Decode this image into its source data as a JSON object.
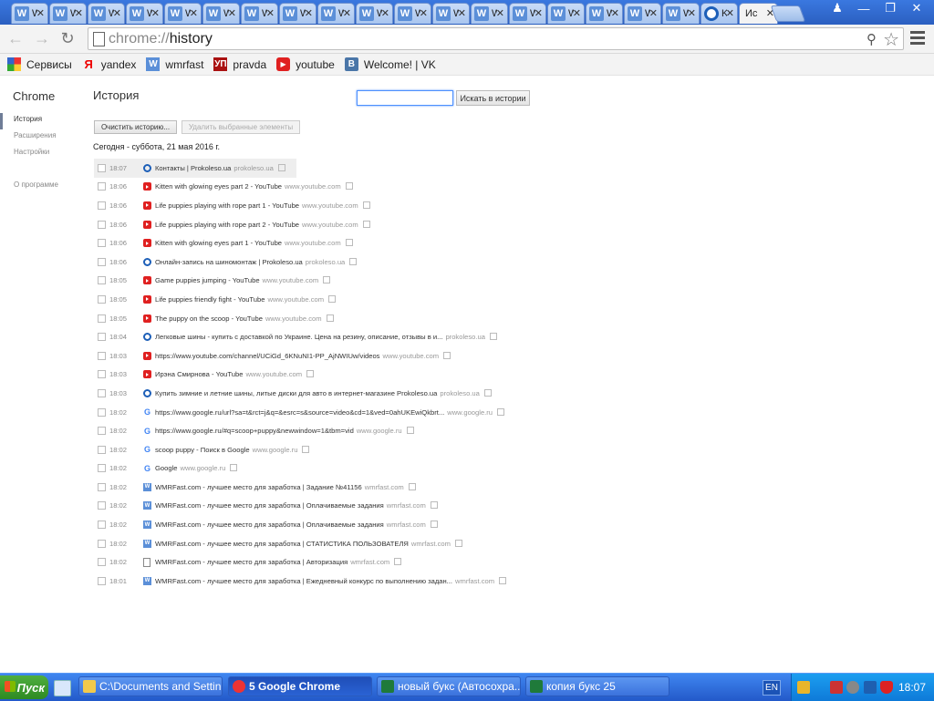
{
  "browser": {
    "tabs": [
      {
        "icon": "w",
        "title": "W"
      },
      {
        "icon": "w",
        "title": "W"
      },
      {
        "icon": "w",
        "title": "W"
      },
      {
        "icon": "w",
        "title": "W"
      },
      {
        "icon": "w",
        "title": "W"
      },
      {
        "icon": "w",
        "title": "W"
      },
      {
        "icon": "w",
        "title": "W"
      },
      {
        "icon": "w",
        "title": "W"
      },
      {
        "icon": "w",
        "title": "W"
      },
      {
        "icon": "w",
        "title": "W"
      },
      {
        "icon": "w",
        "title": "W"
      },
      {
        "icon": "w",
        "title": "W"
      },
      {
        "icon": "w",
        "title": "W"
      },
      {
        "icon": "w",
        "title": "W"
      },
      {
        "icon": "w",
        "title": "W"
      },
      {
        "icon": "w",
        "title": "W"
      },
      {
        "icon": "w",
        "title": "W"
      },
      {
        "icon": "w",
        "title": "W"
      },
      {
        "icon": "prokoleso",
        "title": "K"
      },
      {
        "icon": "none",
        "title": "Ис",
        "active": true
      }
    ],
    "url_scheme": "chrome://",
    "url_host": "history",
    "bookmarks": [
      {
        "icon": "apps",
        "label": "Сервисы"
      },
      {
        "icon": "yandex",
        "label": "yandex"
      },
      {
        "icon": "wmrfast",
        "label": "wmrfast"
      },
      {
        "icon": "pravda",
        "label": "pravda"
      },
      {
        "icon": "youtube",
        "label": "youtube"
      },
      {
        "icon": "vk",
        "label": "Welcome! | VK"
      }
    ]
  },
  "page": {
    "brand": "Chrome",
    "nav": [
      "История",
      "Расширения",
      "Настройки",
      "О программе"
    ],
    "title": "История",
    "search_button": "Искать в истории",
    "clear_button": "Очистить историю...",
    "delete_button": "Удалить выбранные элементы",
    "day_heading": "Сегодня - суббота, 21 мая 2016 г."
  },
  "entries": [
    {
      "time": "18:07",
      "icon": "prokoleso",
      "title": "Контакты | Prokoleso.ua",
      "domain": "prokoleso.ua"
    },
    {
      "time": "18:06",
      "icon": "youtube",
      "title": "Kitten with glowing eyes part 2 - YouTube",
      "domain": "www.youtube.com"
    },
    {
      "time": "18:06",
      "icon": "youtube",
      "title": "Life puppies playing with rope part 1 - YouTube",
      "domain": "www.youtube.com"
    },
    {
      "time": "18:06",
      "icon": "youtube",
      "title": "Life puppies playing with rope part 2 - YouTube",
      "domain": "www.youtube.com"
    },
    {
      "time": "18:06",
      "icon": "youtube",
      "title": "Kitten with glowing eyes part 1 - YouTube",
      "domain": "www.youtube.com"
    },
    {
      "time": "18:06",
      "icon": "prokoleso",
      "title": "Онлайн-запись на шиномонтаж | Prokoleso.ua",
      "domain": "prokoleso.ua"
    },
    {
      "time": "18:05",
      "icon": "youtube",
      "title": "Game puppies jumping - YouTube",
      "domain": "www.youtube.com"
    },
    {
      "time": "18:05",
      "icon": "youtube",
      "title": "Life puppies friendly fight - YouTube",
      "domain": "www.youtube.com"
    },
    {
      "time": "18:05",
      "icon": "youtube",
      "title": "The puppy on the scoop - YouTube",
      "domain": "www.youtube.com"
    },
    {
      "time": "18:04",
      "icon": "prokoleso",
      "title": "Легковые шины - купить с доставкой по Украине. Цена на резину, описание, отзывы в и...",
      "domain": "prokoleso.ua"
    },
    {
      "time": "18:03",
      "icon": "youtube",
      "title": "https://www.youtube.com/channel/UCiGd_6KNuNI1-PP_AjNWIUw/videos",
      "domain": "www.youtube.com"
    },
    {
      "time": "18:03",
      "icon": "youtube",
      "title": "Ирэна Смирнова - YouTube",
      "domain": "www.youtube.com"
    },
    {
      "time": "18:03",
      "icon": "prokoleso",
      "title": "Купить зимние и летние шины, литые диски для авто в интернет-магазине Prokoleso.ua",
      "domain": "prokoleso.ua"
    },
    {
      "time": "18:02",
      "icon": "google",
      "title": "https://www.google.ru/url?sa=t&rct=j&q=&esrc=s&source=video&cd=1&ved=0ahUKEwiQkbrt...",
      "domain": "www.google.ru"
    },
    {
      "time": "18:02",
      "icon": "google",
      "title": "https://www.google.ru/#q=scoop+puppy&newwindow=1&tbm=vid",
      "domain": "www.google.ru"
    },
    {
      "time": "18:02",
      "icon": "google",
      "title": "scoop puppy - Поиск в Google",
      "domain": "www.google.ru"
    },
    {
      "time": "18:02",
      "icon": "google",
      "title": "Google",
      "domain": "www.google.ru"
    },
    {
      "time": "18:02",
      "icon": "wmrfast",
      "title": "WMRFast.com - лучшее место для заработка | Задание №41156",
      "domain": "wmrfast.com"
    },
    {
      "time": "18:02",
      "icon": "wmrfast",
      "title": "WMRFast.com - лучшее место для заработка | Оплачиваемые задания",
      "domain": "wmrfast.com"
    },
    {
      "time": "18:02",
      "icon": "wmrfast",
      "title": "WMRFast.com - лучшее место для заработка | Оплачиваемые задания",
      "domain": "wmrfast.com"
    },
    {
      "time": "18:02",
      "icon": "wmrfast",
      "title": "WMRFast.com - лучшее место для заработка | СТАТИСТИКА ПОЛЬЗОВАТЕЛЯ",
      "domain": "wmrfast.com"
    },
    {
      "time": "18:02",
      "icon": "document",
      "title": "WMRFast.com - лучшее место для заработка | Авторизация",
      "domain": "wmrfast.com"
    },
    {
      "time": "18:01",
      "icon": "wmrfast",
      "title": "WMRFast.com - лучшее место для заработка | Ежедневный конкурс по выполнению задан...",
      "domain": "wmrfast.com"
    }
  ],
  "taskbar": {
    "start": "Пуск",
    "tasks": [
      {
        "icon": "folder",
        "label": "C:\\Documents and Settin..."
      },
      {
        "icon": "chrome",
        "label": "5 Google Chrome",
        "active": true
      },
      {
        "icon": "excel",
        "label": "новый букс (Автосохра..."
      },
      {
        "icon": "excel",
        "label": "копия букс 25"
      }
    ],
    "lang": "EN",
    "clock": "18:07"
  }
}
